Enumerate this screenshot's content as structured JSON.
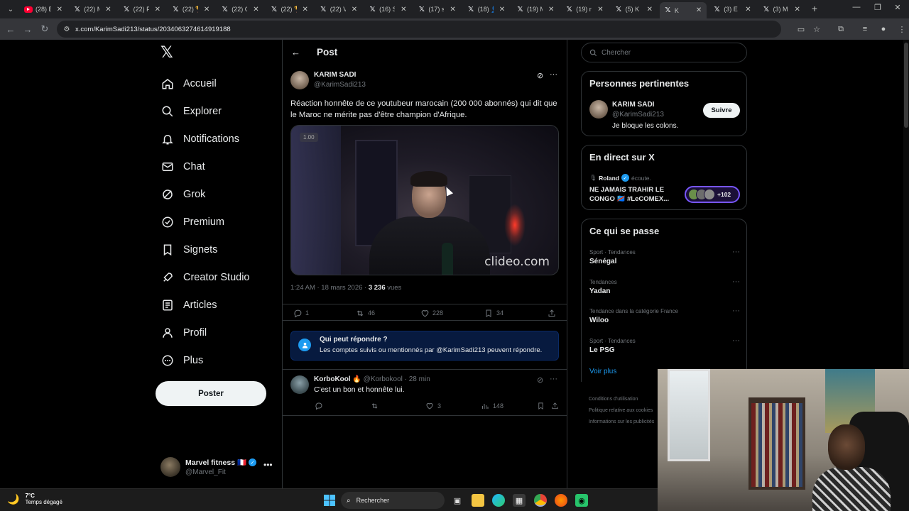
{
  "browser": {
    "tabs": [
      {
        "label": "(28) E",
        "favicon": "youtube"
      },
      {
        "label": "(22) M",
        "favicon": "x"
      },
      {
        "label": "(22) F",
        "favicon": "x"
      },
      {
        "label": "(22) 🏆",
        "favicon": "x"
      },
      {
        "label": "(22) C",
        "favicon": "x"
      },
      {
        "label": "(22) 🏆",
        "favicon": "x"
      },
      {
        "label": "(22) V",
        "favicon": "x"
      },
      {
        "label": "(16) S",
        "favicon": "x"
      },
      {
        "label": "(17) s",
        "favicon": "x"
      },
      {
        "label": "(18) 👤",
        "favicon": "x"
      },
      {
        "label": "(19) M",
        "favicon": "x"
      },
      {
        "label": "(19) n",
        "favicon": "x"
      },
      {
        "label": "(5) K",
        "favicon": "x"
      },
      {
        "label": "K",
        "favicon": "x",
        "active": true
      },
      {
        "label": "(3) E",
        "favicon": "x"
      },
      {
        "label": "(3) M",
        "favicon": "x"
      }
    ],
    "url": "x.com/KarimSadi213/status/2034063274614919188"
  },
  "nav": {
    "items": [
      {
        "label": "Accueil",
        "icon": "home-icon"
      },
      {
        "label": "Explorer",
        "icon": "search-icon"
      },
      {
        "label": "Notifications",
        "icon": "bell-icon"
      },
      {
        "label": "Chat",
        "icon": "mail-icon"
      },
      {
        "label": "Grok",
        "icon": "grok-icon"
      },
      {
        "label": "Premium",
        "icon": "premium-icon"
      },
      {
        "label": "Signets",
        "icon": "bookmark-icon"
      },
      {
        "label": "Creator Studio",
        "icon": "rocket-icon"
      },
      {
        "label": "Articles",
        "icon": "article-icon"
      },
      {
        "label": "Profil",
        "icon": "person-icon"
      },
      {
        "label": "Plus",
        "icon": "more-circle-icon"
      }
    ],
    "post_label": "Poster",
    "account": {
      "name": "Marvel fitness 🇫🇷",
      "handle": "@Marvel_Fit"
    }
  },
  "main": {
    "header_title": "Post",
    "tweet": {
      "name": "KARIM SADI",
      "handle": "@KarimSadi213",
      "text": "Réaction honnête de ce youtubeur marocain (200 000 abonnés) qui dit que le Maroc ne mérite pas d'être champion d'Afrique.",
      "media_badge": "1.00",
      "media_watermark": "clideo.com",
      "time": "1:24 AM · 18 mars 2026 · ",
      "views": "3 236",
      "views_label": " vues",
      "replies": "1",
      "reposts": "46",
      "likes": "228",
      "bookmarks": "34"
    },
    "reply_notice": {
      "title": "Qui peut répondre ?",
      "desc": "Les comptes suivis ou mentionnés par @KarimSadi213 peuvent répondre."
    },
    "reply": {
      "name": "KorboKool 🔥",
      "meta": " @Korbokool · 28 min",
      "text": "C'est un bon et honnête lui.",
      "reposts": "",
      "likes": "3",
      "views": "148"
    }
  },
  "right": {
    "search_placeholder": "Chercher",
    "relevant": {
      "title": "Personnes pertinentes",
      "name": "KARIM SADI",
      "handle": "@KarimSadi213",
      "bio": "Je bloque les colons.",
      "follow_label": "Suivre"
    },
    "live": {
      "title": "En direct sur X",
      "host": "Roland",
      "status": "écoute.",
      "stream_title": "NE JAMAIS TRAHIR LE CONGO 🇨🇩 #LeCOMEX...",
      "count": "+102"
    },
    "trends": {
      "title": "Ce qui se passe",
      "items": [
        {
          "context": "Sport · Tendances",
          "name": "Sénégal"
        },
        {
          "context": "Tendances",
          "name": "Yadan"
        },
        {
          "context": "Tendance dans la catégorie France",
          "name": "Wiloo"
        },
        {
          "context": "Sport · Tendances",
          "name": "Le PSG"
        }
      ],
      "see_more": "Voir plus"
    },
    "footer": [
      "Conditions d'utilisation",
      "Politique relative aux cookies",
      "Informations sur les publicités"
    ]
  },
  "taskbar": {
    "temp": "7°C",
    "condition": "Temps dégagé",
    "search_label": "Rechercher"
  },
  "colors": {
    "accent": "#1d9bf0",
    "live": "#7856ff",
    "bg": "#000000"
  }
}
